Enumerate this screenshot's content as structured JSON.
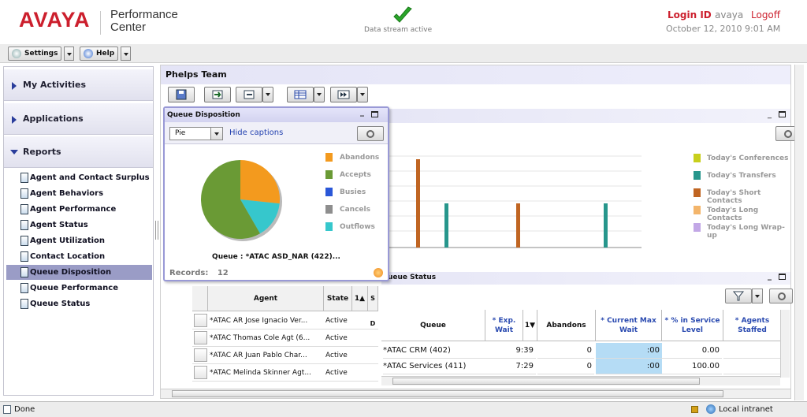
{
  "header": {
    "logo": "AVAYA",
    "product_line1": "Performance",
    "product_line2": "Center",
    "stream_status": "Data stream active",
    "login_label": "Login ID",
    "username": "avaya",
    "logoff_label": "Logoff",
    "datetime": "October 12, 2010 9:01 AM"
  },
  "toolbar": {
    "settings_label": "Settings",
    "help_label": "Help"
  },
  "sidebar": {
    "sections": [
      "My Activities",
      "Applications",
      "Reports"
    ],
    "reports": [
      "Agent and Contact Surplus",
      "Agent Behaviors",
      "Agent Performance",
      "Agent Status",
      "Agent Utilization",
      "Contact Location",
      "Queue Disposition",
      "Queue Performance",
      "Queue Status"
    ],
    "selected_report": "Queue Disposition"
  },
  "main": {
    "team_title": "Phelps Team"
  },
  "bar_chart": {
    "legend": [
      {
        "label": "Today's Conferences",
        "color": "#c8cf1c"
      },
      {
        "label": "Today's Transfers",
        "color": "#27968c"
      },
      {
        "label": "Today's Short Contacts",
        "color": "#c06522"
      },
      {
        "label": "Today's Long Contacts",
        "color": "#f3b56b"
      },
      {
        "label": "Today's Long Wrap-up",
        "color": "#c2a7e6"
      }
    ]
  },
  "queue_disposition": {
    "title": "Queue Disposition",
    "chart_type_value": "Pie",
    "hide_captions": "Hide captions",
    "queue_caption": "Queue : *ATAC ASD_NAR (422)...",
    "records_label": "Records:",
    "records_value": "12",
    "legend": [
      {
        "label": "Abandons",
        "color": "#f39a1e"
      },
      {
        "label": "Accepts",
        "color": "#6a9a35"
      },
      {
        "label": "Busies",
        "color": "#2a57d8"
      },
      {
        "label": "Cancels",
        "color": "#8e8e8e"
      },
      {
        "label": "Outflows",
        "color": "#36c7cc"
      }
    ]
  },
  "agent_table": {
    "headers": [
      "Agent",
      "State",
      "1",
      "S D"
    ],
    "rows": [
      {
        "agent": "*ATAC AR Jose Ignacio Ver...",
        "state": "Active"
      },
      {
        "agent": "*ATAC Thomas Cole Agt (6...",
        "state": "Active"
      },
      {
        "agent": "*ATAC AR Juan Pablo Char...",
        "state": "Active"
      },
      {
        "agent": "*ATAC Melinda Skinner Agt...",
        "state": "Active"
      }
    ]
  },
  "queue_status": {
    "title": "ueue Status",
    "headers": [
      "Queue",
      "* Exp. Wait",
      "1",
      "Abandons",
      "* Current Max Wait",
      "* % in Service Level",
      "* Agents Staffed"
    ],
    "rows": [
      {
        "queue": "*ATAC CRM (402)",
        "exp_wait": "9:39",
        "abandons": "0",
        "current_max_wait": ":00",
        "pct_service": "0.00",
        "agents_staffed": ""
      },
      {
        "queue": "*ATAC Services (411)",
        "exp_wait": "7:29",
        "abandons": "0",
        "current_max_wait": ":00",
        "pct_service": "100.00",
        "agents_staffed": ""
      }
    ]
  },
  "statusbar": {
    "left": "Done",
    "right": "Local intranet"
  },
  "colors": {
    "brand_red": "#cc1f2d",
    "selected_item": "#9a9cc6",
    "highlight_cell": "#b5dcf5"
  }
}
